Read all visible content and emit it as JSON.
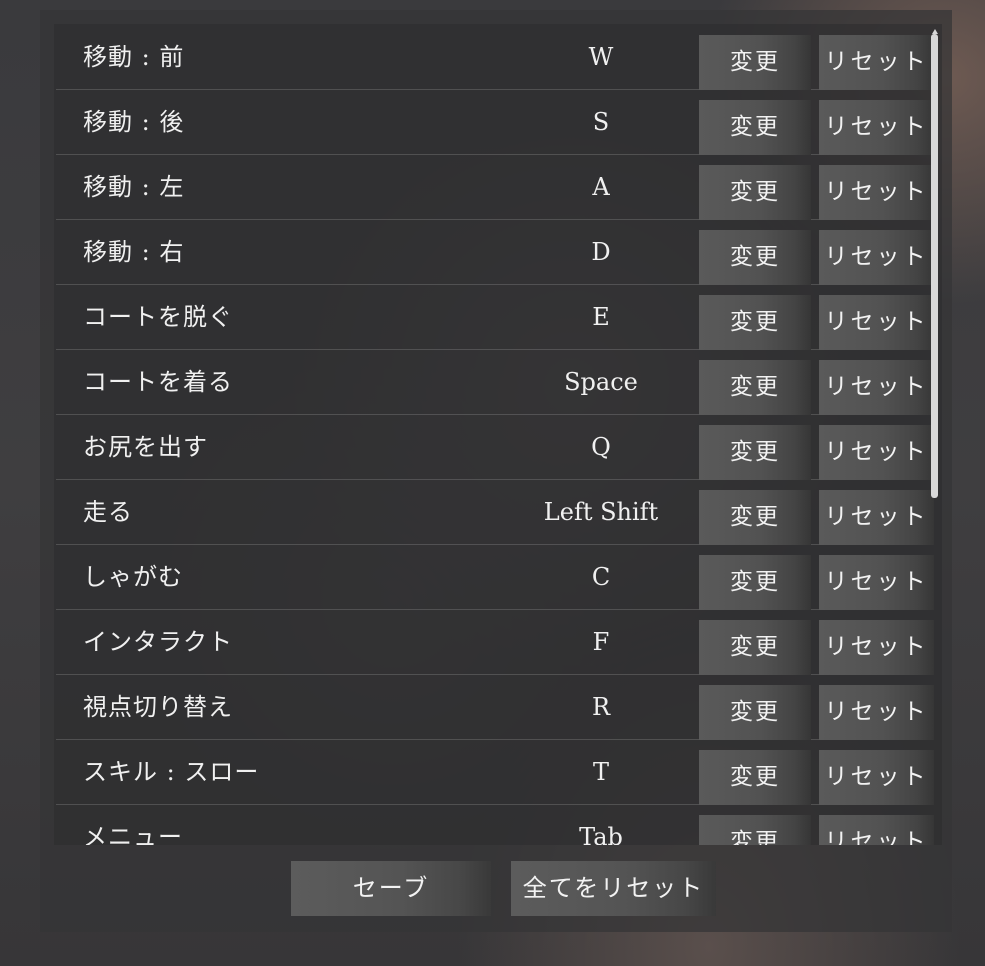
{
  "bindings": [
    {
      "action": "移動 : 前",
      "key": "W"
    },
    {
      "action": "移動 : 後",
      "key": "S"
    },
    {
      "action": "移動 : 左",
      "key": "A"
    },
    {
      "action": "移動 : 右",
      "key": "D"
    },
    {
      "action": "コートを脱ぐ",
      "key": "E"
    },
    {
      "action": "コートを着る",
      "key": "Space"
    },
    {
      "action": "お尻を出す",
      "key": "Q"
    },
    {
      "action": "走る",
      "key": "Left Shift"
    },
    {
      "action": "しゃがむ",
      "key": "C"
    },
    {
      "action": "インタラクト",
      "key": "F"
    },
    {
      "action": "視点切り替え",
      "key": "R"
    },
    {
      "action": "スキル : スロー",
      "key": "T"
    },
    {
      "action": "メニュー",
      "key": "Tab"
    }
  ],
  "row_buttons": {
    "change_label": "変更",
    "reset_label": "リセット"
  },
  "footer": {
    "save_label": "セーブ",
    "reset_all_label": "全てをリセット"
  },
  "colors": {
    "text": "#f0f0f0",
    "button": "#565656",
    "scrollbar_thumb": "#d8d8d8"
  }
}
